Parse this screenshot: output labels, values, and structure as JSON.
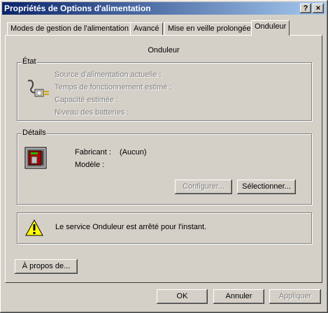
{
  "window": {
    "title": "Propriétés de Options d'alimentation",
    "help_glyph": "?",
    "close_glyph": "×"
  },
  "tabs": [
    {
      "label": "Modes de gestion de l'alimentation",
      "active": false
    },
    {
      "label": "Avancé",
      "active": false
    },
    {
      "label": "Mise en veille prolongée",
      "active": false
    },
    {
      "label": "Onduleur",
      "active": true
    }
  ],
  "panel": {
    "title": "Onduleur"
  },
  "etat": {
    "legend": "État",
    "icon": "power-plug-icon",
    "rows": [
      "Source d'alimentation actuelle :",
      "Temps de fonctionnement estimé :",
      "Capacité estimée :",
      "Niveau des batteries :"
    ]
  },
  "details": {
    "legend": "Détails",
    "icon": "ups-device-icon",
    "fabricant_label": "Fabricant :",
    "fabricant_value": "(Aucun)",
    "modele_label": "Modèle :",
    "configure_button": "Configurer...",
    "select_button": "Sélectionner..."
  },
  "notice": {
    "icon": "warning-icon",
    "text": "Le service Onduleur est arrêté pour l'instant."
  },
  "about_button": "À propos de...",
  "footer": {
    "ok": "OK",
    "cancel": "Annuler",
    "apply": "Appliquer"
  },
  "colors": {
    "title_start": "#0a246a",
    "title_end": "#a6caf0",
    "face": "#d4d0c8",
    "disabled_text": "#808080"
  }
}
